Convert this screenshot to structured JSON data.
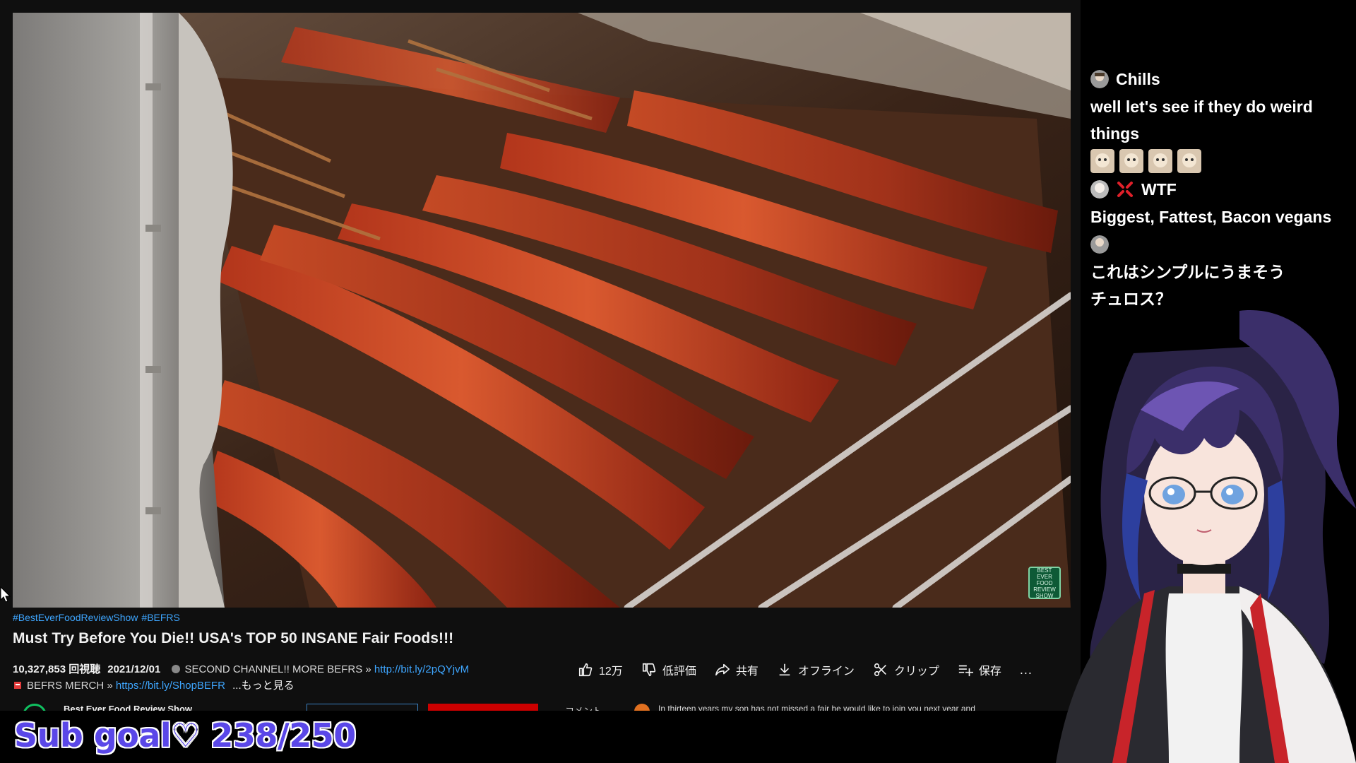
{
  "video": {
    "hashtags": [
      "#BestEverFoodReviewShow",
      "#BEFRS"
    ],
    "title": "Must Try Before You Die!! USA's TOP 50 INSANE Fair Foods!!!",
    "views": "10,327,853 回視聴",
    "date": "2021/12/01",
    "desc_line1": "SECOND CHANNEL!! MORE BEFRS »",
    "desc_link1": "http://bit.ly/2pQYjvM",
    "desc_line2": "BEFRS MERCH »",
    "desc_link2": "https://bit.ly/ShopBEFR",
    "show_more": "...もっと見る",
    "watermark": "BEST EVER FOOD REVIEW SHOW"
  },
  "actions": {
    "like_count": "12万",
    "dislike_label": "低評価",
    "share_label": "共有",
    "offline_label": "オフライン",
    "clip_label": "クリップ",
    "save_label": "保存",
    "more_label": "..."
  },
  "peek": {
    "channel_name": "Best Ever Food Review Show",
    "comment_label": "コメント",
    "comment_text": "In thirteen years my son has not missed a fair he would like to join you next year and"
  },
  "overlay": {
    "subgoal": "Sub goal♡ 238/250"
  },
  "chat": {
    "messages": [
      {
        "user": "Chills",
        "text": "well let's see if they do weird things"
      },
      {
        "user": "WTF",
        "text": "Biggest, Fattest, Bacon vegans"
      },
      {
        "user": "",
        "text": "これはシンプルにうまそう"
      },
      {
        "user": "",
        "text": "チュロス？"
      }
    ]
  },
  "colors": {
    "accent_link": "#3ea6ff",
    "subgoal_text": "#5a47e8",
    "page_bg": "#0f0f0f"
  }
}
